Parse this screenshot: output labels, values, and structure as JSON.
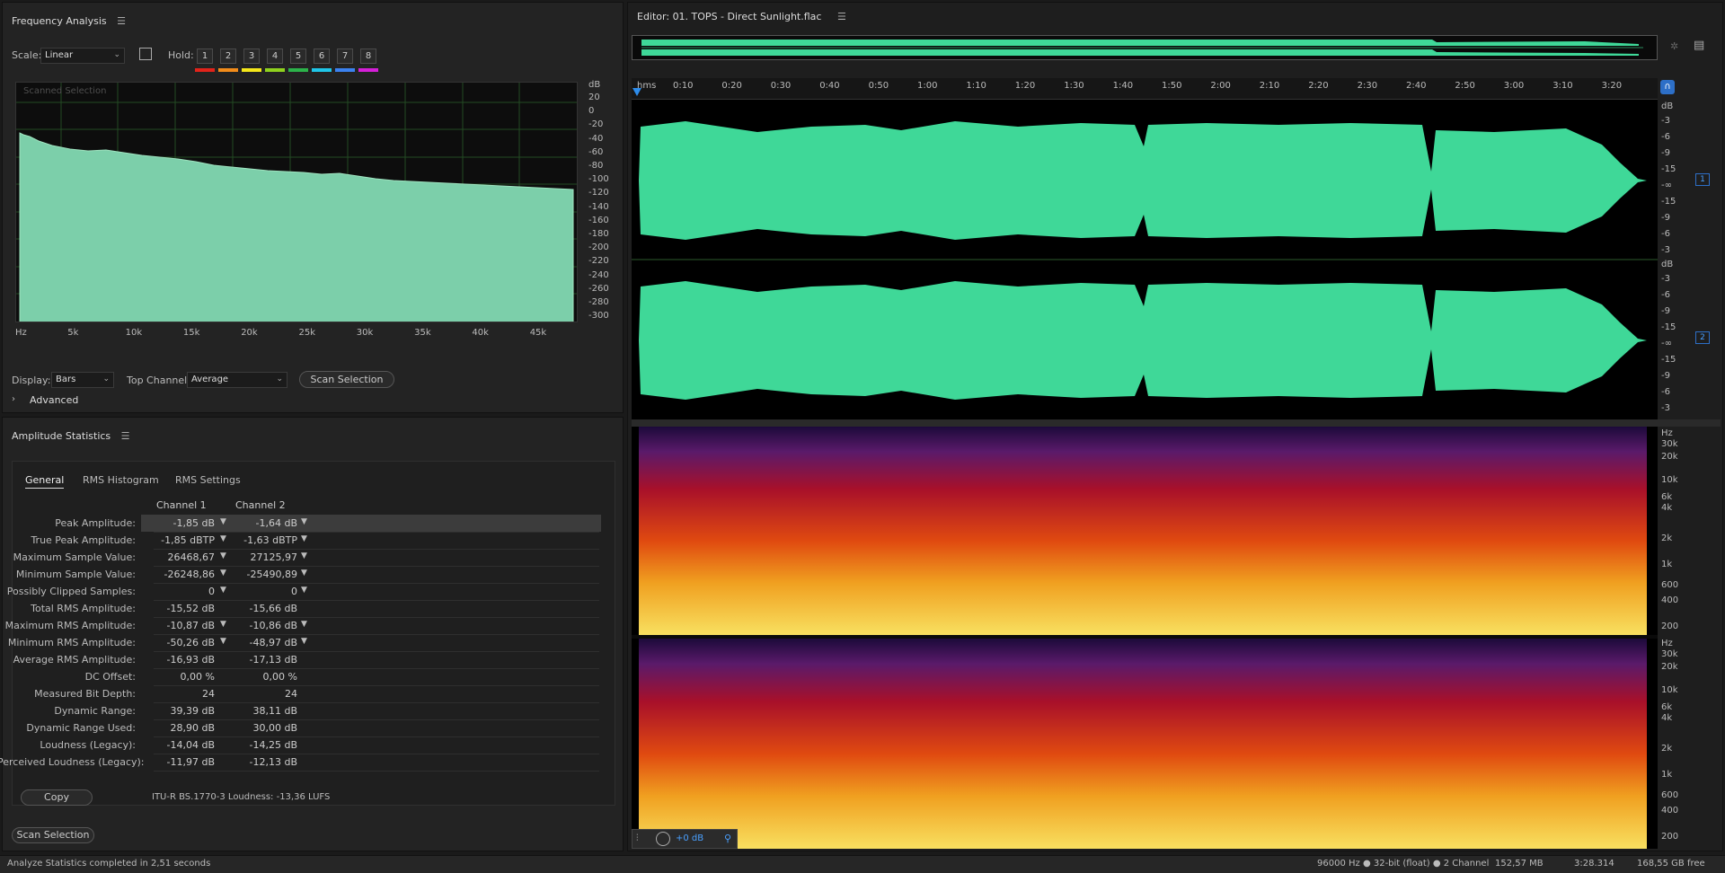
{
  "freq": {
    "title": "Frequency Analysis",
    "scale_label": "Scale:",
    "scale_value": "Linear",
    "hold_label": "Hold:",
    "hold_buttons": [
      "1",
      "2",
      "3",
      "4",
      "5",
      "6",
      "7",
      "8"
    ],
    "hold_colors": [
      "#e2231a",
      "#f28c1a",
      "#f5e71a",
      "#8fd21e",
      "#2cb34a",
      "#1fc6e8",
      "#3b82f0",
      "#d51fd8"
    ],
    "graph_label": "Scanned Selection",
    "x_ticks": [
      "Hz",
      "5k",
      "10k",
      "15k",
      "20k",
      "25k",
      "30k",
      "35k",
      "40k",
      "45k"
    ],
    "y_unit": "dB",
    "y_ticks": [
      "20",
      "0",
      "-20",
      "-40",
      "-60",
      "-80",
      "-100",
      "-120",
      "-140",
      "-160",
      "-180",
      "-200",
      "-220",
      "-240",
      "-260",
      "-280",
      "-300"
    ],
    "display_label": "Display:",
    "display_value": "Bars",
    "top_channel_label": "Top Channel:",
    "top_channel_value": "Average",
    "scan_button": "Scan Selection",
    "advanced_label": "Advanced"
  },
  "amp": {
    "title": "Amplitude Statistics",
    "tabs": [
      "General",
      "RMS Histogram",
      "RMS Settings"
    ],
    "col1": "Channel 1",
    "col2": "Channel 2",
    "rows": [
      {
        "name": "Peak Amplitude:",
        "c1": "-1,85 dB",
        "c2": "-1,64 dB"
      },
      {
        "name": "True Peak Amplitude:",
        "c1": "-1,85 dBTP",
        "c2": "-1,63 dBTP"
      },
      {
        "name": "Maximum Sample Value:",
        "c1": "26468,67",
        "c2": "27125,97"
      },
      {
        "name": "Minimum Sample Value:",
        "c1": "-26248,86",
        "c2": "-25490,89"
      },
      {
        "name": "Possibly Clipped Samples:",
        "c1": "0",
        "c2": "0"
      },
      {
        "name": "Total RMS Amplitude:",
        "c1": "-15,52 dB",
        "c2": "-15,66 dB"
      },
      {
        "name": "Maximum RMS Amplitude:",
        "c1": "-10,87 dB",
        "c2": "-10,86 dB"
      },
      {
        "name": "Minimum RMS Amplitude:",
        "c1": "-50,26 dB",
        "c2": "-48,97 dB"
      },
      {
        "name": "Average RMS Amplitude:",
        "c1": "-16,93 dB",
        "c2": "-17,13 dB"
      },
      {
        "name": "DC Offset:",
        "c1": "0,00 %",
        "c2": "0,00 %"
      },
      {
        "name": "Measured Bit Depth:",
        "c1": "24",
        "c2": "24"
      },
      {
        "name": "Dynamic Range:",
        "c1": "39,39 dB",
        "c2": "38,11 dB"
      },
      {
        "name": "Dynamic Range Used:",
        "c1": "28,90 dB",
        "c2": "30,00 dB"
      },
      {
        "name": "Loudness (Legacy):",
        "c1": "-14,04 dB",
        "c2": "-14,25 dB"
      },
      {
        "name": "Perceived Loudness (Legacy):",
        "c1": "-11,97 dB",
        "c2": "-12,13 dB"
      }
    ],
    "copy_button": "Copy",
    "loudness_text": "ITU-R BS.1770-3 Loudness: -13,36 LUFS",
    "scan_button": "Scan Selection"
  },
  "editor": {
    "title": "Editor: 01. TOPS - Direct Sunlight.flac",
    "time_unit": "hms",
    "time_ticks": [
      "0:10",
      "0:20",
      "0:30",
      "0:40",
      "0:50",
      "1:00",
      "1:10",
      "1:20",
      "1:30",
      "1:40",
      "1:50",
      "2:00",
      "2:10",
      "2:20",
      "2:30",
      "2:40",
      "2:50",
      "3:00",
      "3:10",
      "3:20"
    ],
    "db_label": "dB",
    "db_ticks_ch": [
      "-3",
      "-6",
      "-9",
      "-15",
      "-∞",
      "-15",
      "-9",
      "-6",
      "-3"
    ],
    "channel_labels": [
      "1",
      "2"
    ],
    "hz_label": "Hz",
    "hz_ticks": [
      "30k",
      "20k",
      "10k",
      "6k",
      "4k",
      "2k",
      "1k",
      "600",
      "400",
      "200"
    ],
    "gain_value": "+0 dB"
  },
  "status": {
    "left": "Analyze Statistics completed in 2,51 seconds",
    "format": "96000 Hz ● 32-bit (float) ● 2 Channel",
    "size": "152,57 MB",
    "duration": "3:28.314",
    "free": "168,55 GB free"
  },
  "colors": {
    "waveform": "#3fd898",
    "accent": "#2d8ceb"
  }
}
